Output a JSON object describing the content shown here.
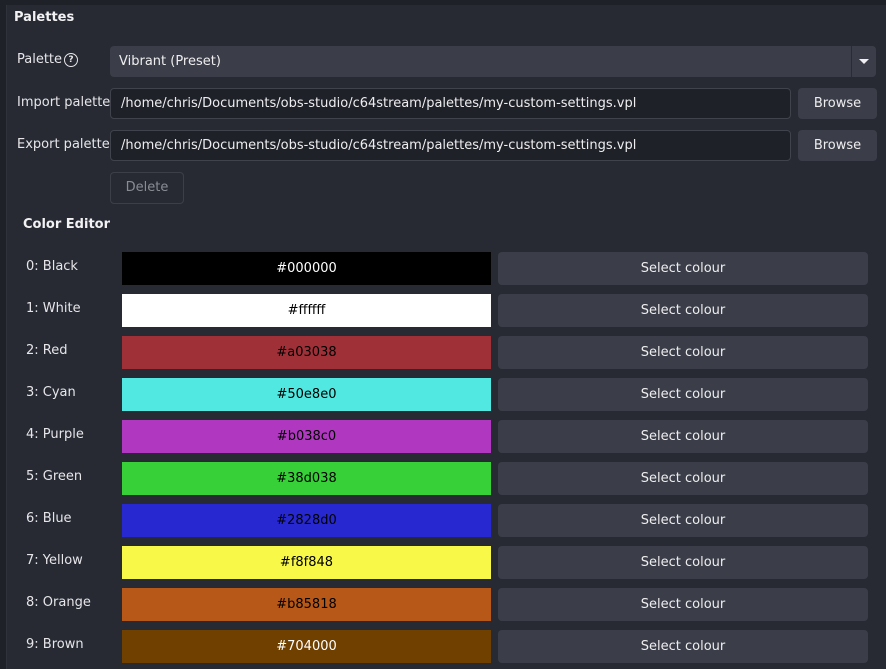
{
  "palettes": {
    "title": "Palettes",
    "palette_label": "Palette",
    "palette_value": "Vibrant (Preset)",
    "import_label": "Import palette",
    "import_path": "/home/chris/Documents/obs-studio/c64stream/palettes/my-custom-settings.vpl",
    "export_label": "Export palette",
    "export_path": "/home/chris/Documents/obs-studio/c64stream/palettes/my-custom-settings.vpl",
    "browse_label": "Browse",
    "delete_label": "Delete",
    "help_icon": "question-circle-icon"
  },
  "editor": {
    "title": "Color Editor",
    "select_label": "Select colour",
    "colors": [
      {
        "label": "0: Black",
        "hex": "#000000",
        "text_color": "#ffffff"
      },
      {
        "label": "1: White",
        "hex": "#ffffff",
        "text_color": "#000000"
      },
      {
        "label": "2: Red",
        "hex": "#a03038",
        "text_color": "#000000"
      },
      {
        "label": "3: Cyan",
        "hex": "#50e8e0",
        "text_color": "#000000"
      },
      {
        "label": "4: Purple",
        "hex": "#b038c0",
        "text_color": "#000000"
      },
      {
        "label": "5: Green",
        "hex": "#38d038",
        "text_color": "#000000"
      },
      {
        "label": "6: Blue",
        "hex": "#2828d0",
        "text_color": "#000000"
      },
      {
        "label": "7: Yellow",
        "hex": "#f8f848",
        "text_color": "#000000"
      },
      {
        "label": "8: Orange",
        "hex": "#b85818",
        "text_color": "#000000"
      },
      {
        "label": "9: Brown",
        "hex": "#704000",
        "text_color": "#ffffff"
      }
    ]
  }
}
